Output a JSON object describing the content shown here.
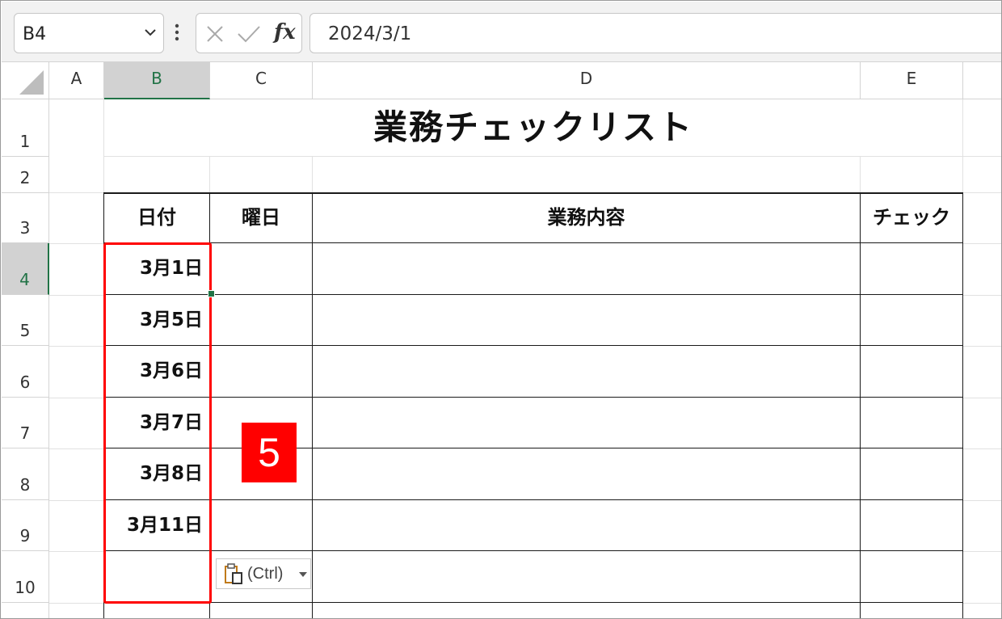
{
  "formula_bar": {
    "name_box": "B4",
    "formula": "2024/3/1"
  },
  "columns": [
    "A",
    "B",
    "C",
    "D",
    "E"
  ],
  "rows": [
    "1",
    "2",
    "3",
    "4",
    "5",
    "6",
    "7",
    "8",
    "9",
    "10"
  ],
  "sheet": {
    "title": "業務チェックリスト",
    "headers": {
      "date": "日付",
      "weekday": "曜日",
      "task": "業務内容",
      "check": "チェック"
    },
    "dates": [
      "3月1日",
      "3月5日",
      "3月6日",
      "3月7日",
      "3月8日",
      "3月11日",
      ""
    ]
  },
  "badge": "5",
  "paste_options": {
    "label": "(Ctrl)"
  },
  "colors": {
    "accent_green": "#217346",
    "highlight_red": "#ff0000"
  },
  "icons": [
    "chevron-down-icon",
    "more-vertical-icon",
    "cancel-icon",
    "enter-icon",
    "function-icon",
    "clipboard-paste-icon",
    "dropdown-arrow-icon"
  ]
}
